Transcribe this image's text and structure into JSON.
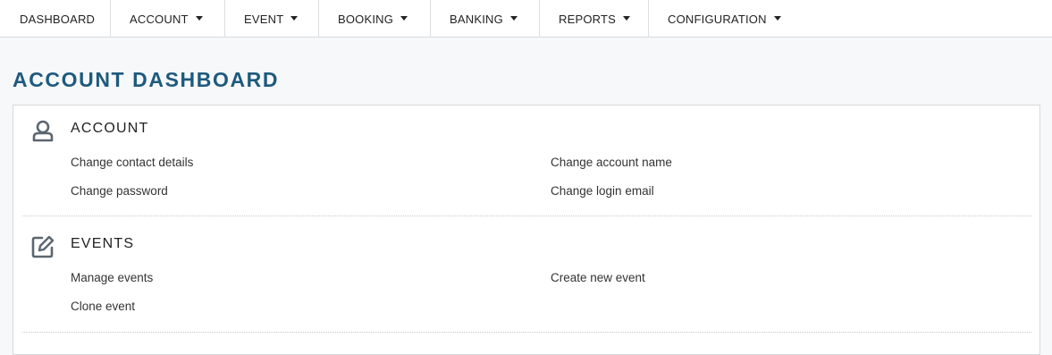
{
  "nav": {
    "items": [
      {
        "label": "DASHBOARD",
        "has_dropdown": false
      },
      {
        "label": "ACCOUNT",
        "has_dropdown": true
      },
      {
        "label": "EVENT",
        "has_dropdown": true
      },
      {
        "label": "BOOKING",
        "has_dropdown": true
      },
      {
        "label": "BANKING",
        "has_dropdown": true
      },
      {
        "label": "REPORTS",
        "has_dropdown": true
      },
      {
        "label": "CONFIGURATION",
        "has_dropdown": true
      }
    ]
  },
  "page": {
    "title": "ACCOUNT DASHBOARD"
  },
  "sections": [
    {
      "title": "ACCOUNT",
      "icon": "user-icon",
      "links": [
        "Change contact details",
        "Change account name",
        "Change password",
        "Change login email"
      ]
    },
    {
      "title": "EVENTS",
      "icon": "edit-icon",
      "links": [
        "Manage events",
        "Create new event",
        "Clone event"
      ]
    }
  ],
  "colors": {
    "title": "#1e5a7e",
    "icon": "#5b6670",
    "background": "#f7f8f9"
  }
}
